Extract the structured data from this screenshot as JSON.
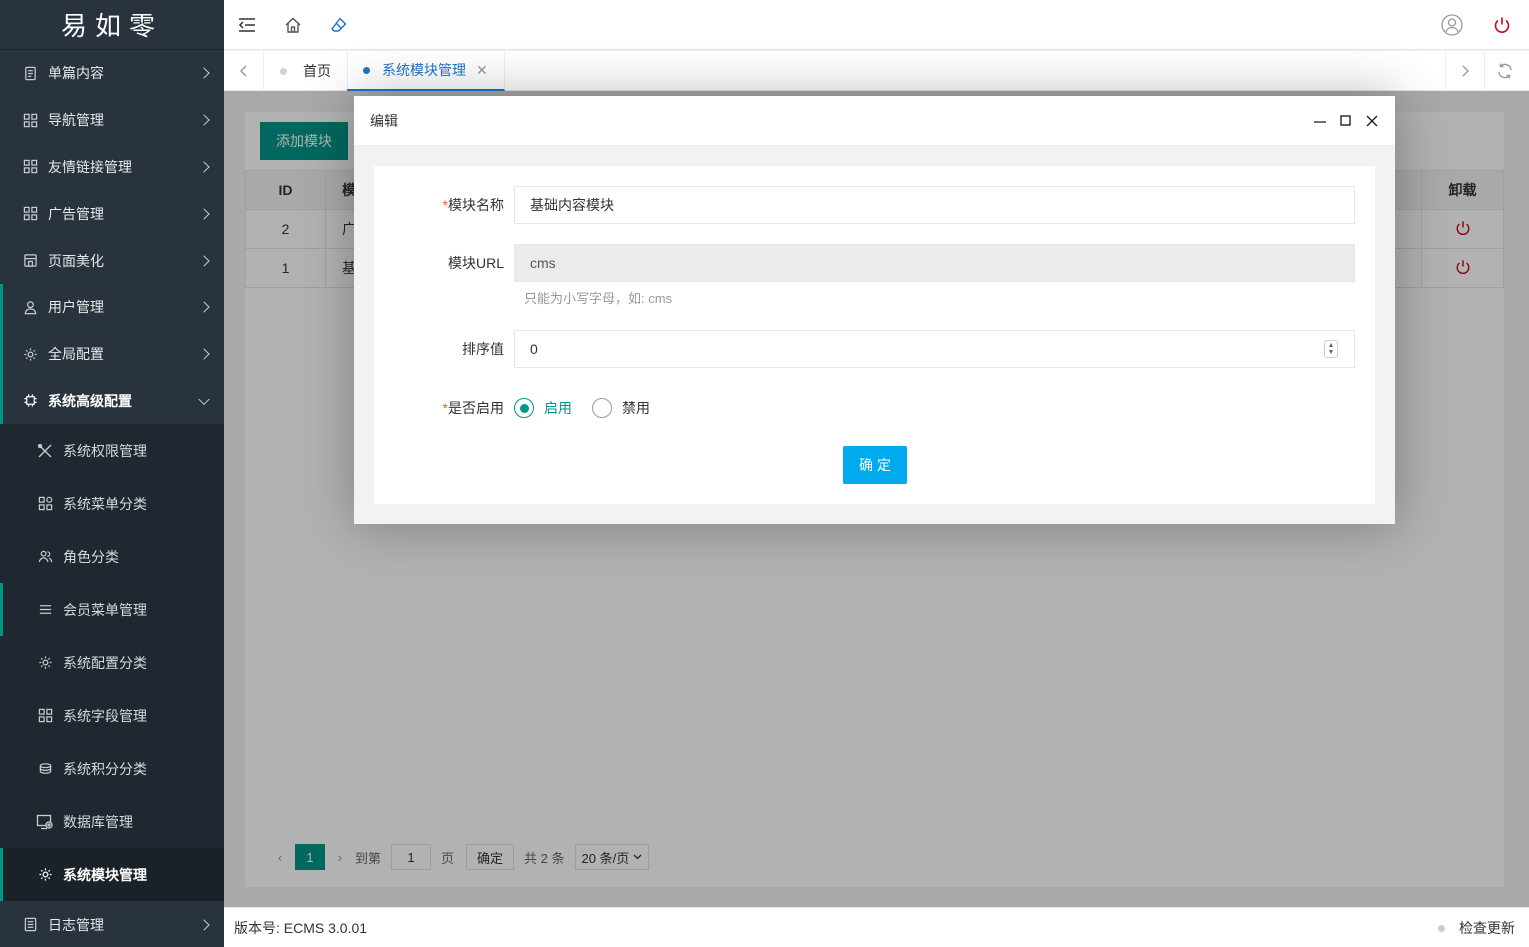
{
  "logo": {
    "text": "易如零"
  },
  "sidebar": {
    "items": [
      {
        "label": "单篇内容"
      },
      {
        "label": "导航管理"
      },
      {
        "label": "友情链接管理"
      },
      {
        "label": "广告管理"
      },
      {
        "label": "页面美化"
      },
      {
        "label": "用户管理"
      },
      {
        "label": "全局配置"
      },
      {
        "label": "系统高级配置"
      },
      {
        "label": "日志管理"
      }
    ],
    "subitems": [
      {
        "label": "系统权限管理"
      },
      {
        "label": "系统菜单分类"
      },
      {
        "label": "角色分类"
      },
      {
        "label": "会员菜单管理"
      },
      {
        "label": "系统配置分类"
      },
      {
        "label": "系统字段管理"
      },
      {
        "label": "系统积分分类"
      },
      {
        "label": "数据库管理"
      },
      {
        "label": "系统模块管理"
      }
    ]
  },
  "tabs": [
    {
      "label": "首页"
    },
    {
      "label": "系统模块管理"
    }
  ],
  "main": {
    "add_button": "添加模块",
    "table": {
      "headers": [
        "ID",
        "模",
        "卸载"
      ],
      "rows": [
        {
          "id": "2",
          "name": "广"
        },
        {
          "id": "1",
          "name": "基"
        }
      ]
    },
    "pager": {
      "current": "1",
      "goto_label": "到第",
      "page_input": "1",
      "page_unit": "页",
      "ok": "确定",
      "total": "共 2 条",
      "page_size": "20 条/页"
    }
  },
  "modal": {
    "title": "编辑",
    "fields": {
      "name": {
        "required": "*",
        "label": "模块名称",
        "value": "基础内容模块"
      },
      "url": {
        "label": "模块URL",
        "value": "cms",
        "hint": "只能为小写字母，如: cms"
      },
      "sort": {
        "label": "排序值",
        "value": "0"
      },
      "enabled": {
        "required": "*",
        "label": "是否启用",
        "on": "启用",
        "off": "禁用"
      }
    },
    "submit": "确定"
  },
  "footer": {
    "version": "版本号: ECMS 3.0.01",
    "check_update": "检查更新"
  },
  "colors": {
    "sidebar_bg": "#28333e",
    "primary": "#009688",
    "submit_blue": "#01aaed",
    "tab_active": "#1e74c8",
    "power_red": "#d0021b"
  }
}
